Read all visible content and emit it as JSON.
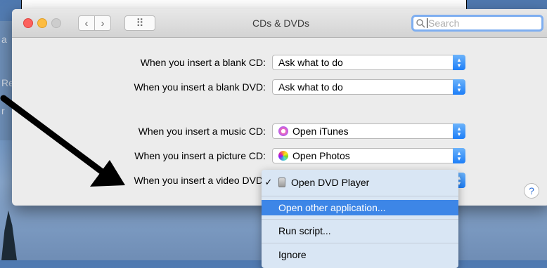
{
  "window": {
    "title": "CDs & DVDs"
  },
  "toolbar": {
    "back": "‹",
    "forward": "›",
    "grid": "⠿",
    "search_placeholder": "Search",
    "search_value": "",
    "search_shown_text": "Search"
  },
  "settings": [
    {
      "label": "When you insert a blank CD:",
      "value": "Ask what to do",
      "icon": ""
    },
    {
      "label": "When you insert a blank DVD:",
      "value": "Ask what to do",
      "icon": ""
    },
    {
      "label": "When you insert a music CD:",
      "value": "Open iTunes",
      "icon": "itunes-icon"
    },
    {
      "label": "When you insert a picture CD:",
      "value": "Open Photos",
      "icon": "photos-icon"
    },
    {
      "label": "When you insert a video DVD:",
      "value": "Open DVD Player",
      "icon": "dvd-player-icon"
    }
  ],
  "menu": {
    "items": [
      {
        "label": "Open DVD Player",
        "checked": true,
        "icon": "dvd-player-icon"
      },
      {
        "label": "Open other application...",
        "highlighted": true
      },
      {
        "label": "Run script..."
      },
      {
        "label": "Ignore"
      }
    ]
  },
  "help": {
    "label": "?"
  },
  "background": {
    "letters": [
      "a",
      "Re",
      "r"
    ]
  },
  "colors": {
    "accent": "#3d86e7",
    "search_focus": "#7eaef0"
  }
}
